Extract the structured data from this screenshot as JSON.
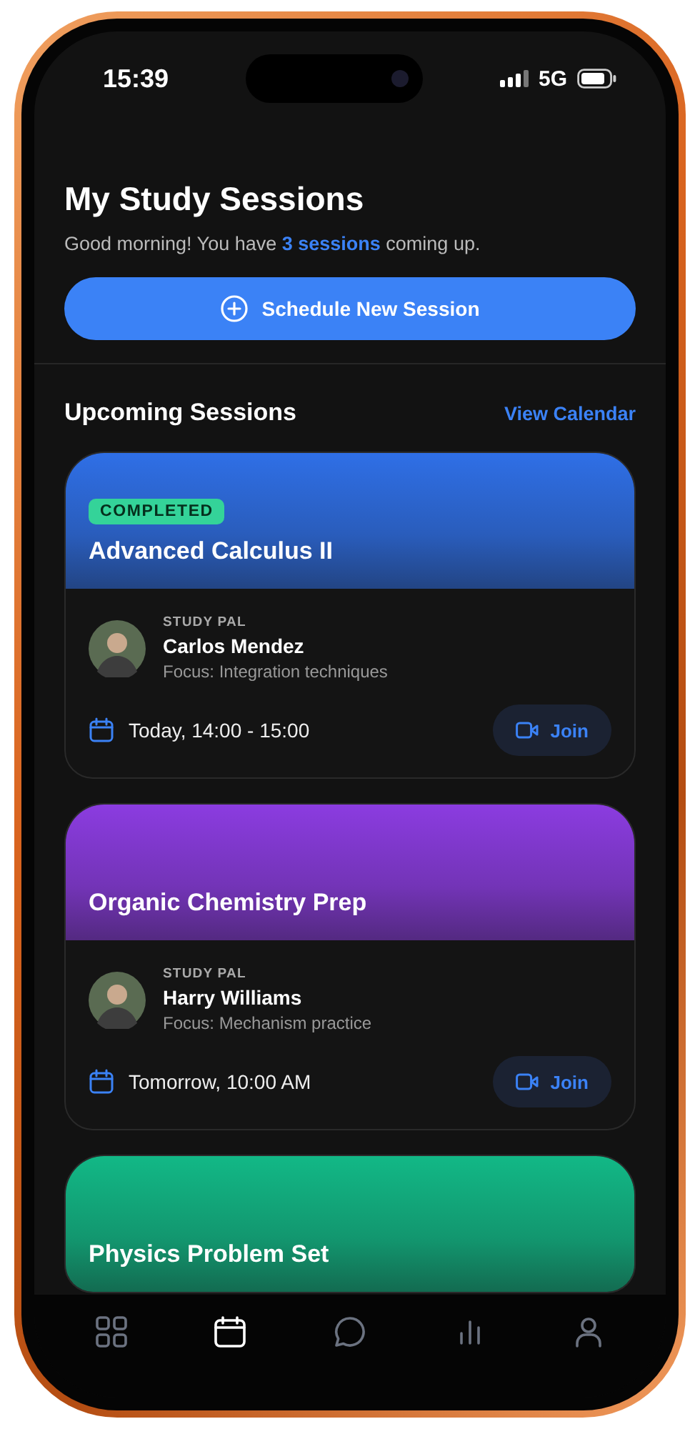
{
  "status_bar": {
    "time": "15:39",
    "network": "5G"
  },
  "header": {
    "title": "My Study Sessions",
    "subtitle": "Good morning! You have **3 sessions** coming up."
  },
  "schedule_button": {
    "label": "Schedule New Session"
  },
  "section": {
    "title": "Upcoming Sessions",
    "link": "View Calendar"
  },
  "sessions": [
    {
      "title": "Advanced Calculus II",
      "badge": "COMPLETED",
      "color": "#2f6fe6",
      "pal_label": "STUDY PAL",
      "pal_name": "Carlos Mendez",
      "focus": "Focus: Integration techniques",
      "time": "Today, 14:00 - 15:00",
      "action": "Join"
    },
    {
      "title": "Organic Chemistry Prep",
      "color": "#8b3ce0",
      "pal_label": "STUDY PAL",
      "pal_name": "Harry Williams",
      "focus": "Focus: Mechanism practice",
      "time": "Tomorrow, 10:00 AM",
      "action": "Join"
    },
    {
      "title": "Physics Problem Set",
      "color": "#12b886"
    }
  ],
  "nav": [
    {
      "kind": "grid",
      "selected": false
    },
    {
      "kind": "calendar",
      "selected": true
    },
    {
      "kind": "chat",
      "selected": false
    },
    {
      "kind": "chart",
      "selected": false
    },
    {
      "kind": "user",
      "selected": false
    }
  ]
}
